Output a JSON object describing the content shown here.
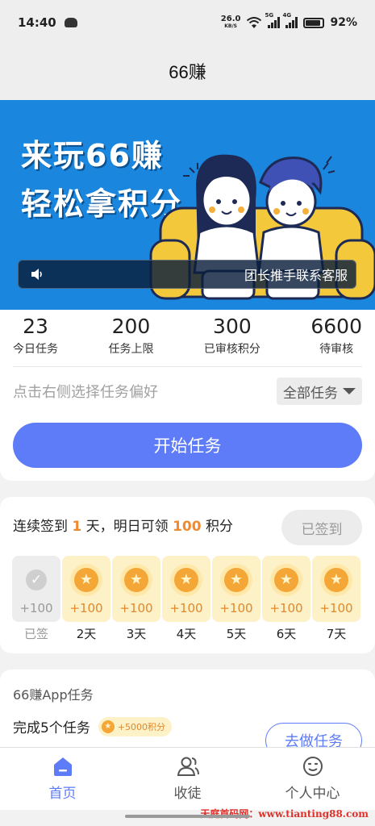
{
  "status_bar": {
    "time": "14:40",
    "net_speed": "26.0",
    "net_unit": "KB/S",
    "signal_tag_1": "5G",
    "signal_tag_2": "4G",
    "battery": "92%"
  },
  "header": {
    "title": "66赚"
  },
  "banner": {
    "line1": "来玩66赚",
    "line2": "轻松拿积分",
    "notice": "团长推手联系客服"
  },
  "stats": [
    {
      "value": "23",
      "label": "今日任务"
    },
    {
      "value": "200",
      "label": "任务上限"
    },
    {
      "value": "300",
      "label": "已审核积分"
    },
    {
      "value": "6600",
      "label": "待审核"
    }
  ],
  "preference": {
    "hint": "点击右侧选择任务偏好",
    "selected": "全部任务"
  },
  "start_button": "开始任务",
  "signin": {
    "prefix": "连续签到",
    "days_count": "1",
    "middle": "天，明日可领",
    "reward_points": "100",
    "suffix": "积分",
    "button": "已签到",
    "days": [
      {
        "amount": "+100",
        "label": "已签",
        "done": true
      },
      {
        "amount": "+100",
        "label": "2天",
        "done": false
      },
      {
        "amount": "+100",
        "label": "3天",
        "done": false
      },
      {
        "amount": "+100",
        "label": "4天",
        "done": false
      },
      {
        "amount": "+100",
        "label": "5天",
        "done": false
      },
      {
        "amount": "+100",
        "label": "6天",
        "done": false
      },
      {
        "amount": "+100",
        "label": "7天",
        "done": false
      }
    ]
  },
  "tasks": {
    "title": "66赚App任务",
    "item_name": "完成5个任务",
    "item_reward": "+5000积分",
    "item_button": "去做任务"
  },
  "tabbar": [
    {
      "label": "首页",
      "icon": "home-icon",
      "active": true
    },
    {
      "label": "收徒",
      "icon": "users-icon",
      "active": false
    },
    {
      "label": "个人中心",
      "icon": "profile-icon",
      "active": false
    }
  ],
  "watermark": "天庭首码网：www.tianting88.com",
  "colors": {
    "primary": "#5e7cf7",
    "banner_bg": "#1a86de",
    "accent_orange": "#f08a2f",
    "coin_bg": "#fdf1c8"
  }
}
